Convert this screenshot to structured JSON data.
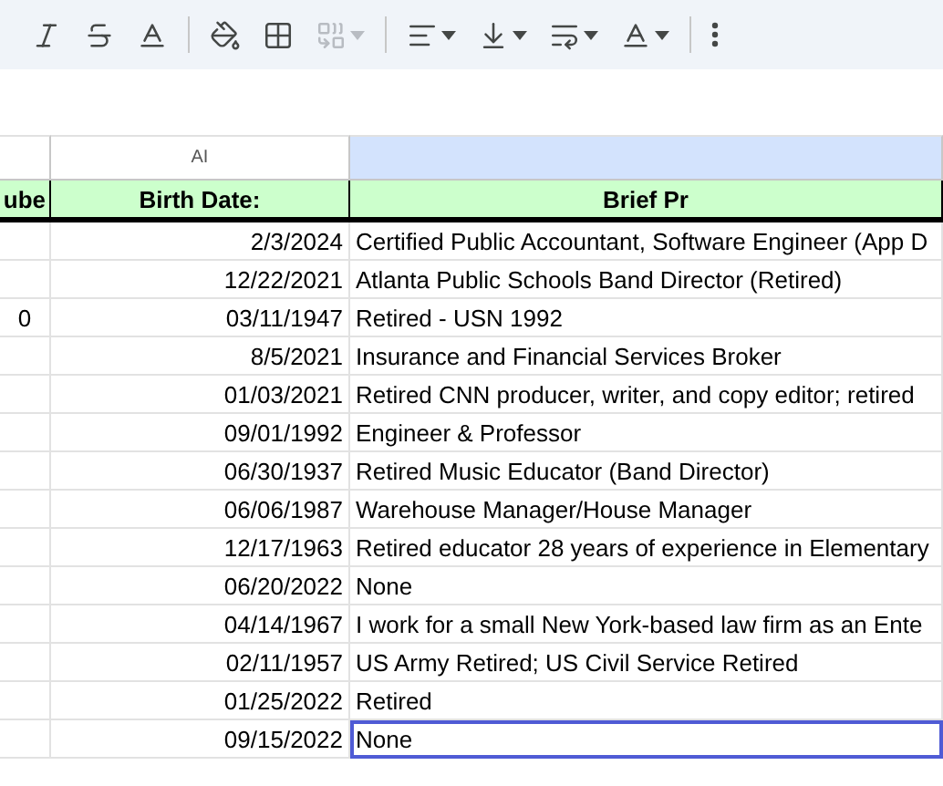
{
  "toolbar": {
    "groups": [
      [
        {
          "disabled": false,
          "dropdown": false
        },
        {
          "disabled": false,
          "dropdown": false
        },
        {
          "disabled": false,
          "dropdown": false
        }
      ],
      [
        {
          "disabled": false,
          "dropdown": false
        },
        {
          "disabled": false,
          "dropdown": false
        },
        {
          "disabled": true,
          "dropdown": true
        }
      ],
      [
        {
          "disabled": false,
          "dropdown": true
        },
        {
          "disabled": false,
          "dropdown": true
        },
        {
          "disabled": false,
          "dropdown": true
        },
        {
          "disabled": false,
          "dropdown": true
        }
      ],
      [
        {
          "disabled": false,
          "dropdown": false
        }
      ]
    ]
  },
  "column_headers": [
    {
      "selected": false
    },
    {
      "label": "AI",
      "selected": false
    },
    {
      "selected": true
    }
  ],
  "header_row": [
    "ube",
    "Birth Date:",
    "Brief Pr"
  ],
  "rows": [
    {
      "birth_date": "2/3/2024",
      "profession": "Certified Public Accountant, Software Engineer (App D",
      "selected": false
    },
    {
      "birth_date": "12/22/2021",
      "profession": "Atlanta Public Schools Band Director (Retired)",
      "selected": false
    },
    {
      "column_1": "0",
      "birth_date": "03/11/1947",
      "profession": "Retired - USN 1992",
      "selected": false
    },
    {
      "birth_date": "8/5/2021",
      "profession": "Insurance and Financial Services Broker",
      "selected": false
    },
    {
      "birth_date": "01/03/2021",
      "profession": "Retired CNN producer, writer, and copy editor; retired",
      "selected": false
    },
    {
      "birth_date": "09/01/1992",
      "profession": "Engineer & Professor",
      "selected": false
    },
    {
      "birth_date": "06/30/1937",
      "profession": "Retired Music Educator (Band Director)",
      "selected": false
    },
    {
      "birth_date": "06/06/1987",
      "profession": "Warehouse Manager/House Manager",
      "selected": false
    },
    {
      "birth_date": "12/17/1963",
      "profession": "Retired educator 28 years of experience in Elementary",
      "selected": false
    },
    {
      "birth_date": "06/20/2022",
      "profession": "None",
      "selected": false
    },
    {
      "birth_date": "04/14/1967",
      "profession": "I work for a small New York-based law firm as an Ente",
      "selected": false
    },
    {
      "birth_date": "02/11/1957",
      "profession": "US Army Retired; US Civil Service Retired",
      "selected": false
    },
    {
      "birth_date": "01/25/2022",
      "profession": "Retired",
      "selected": false
    },
    {
      "birth_date": "09/15/2022",
      "profession": "None",
      "selected": true
    }
  ]
}
